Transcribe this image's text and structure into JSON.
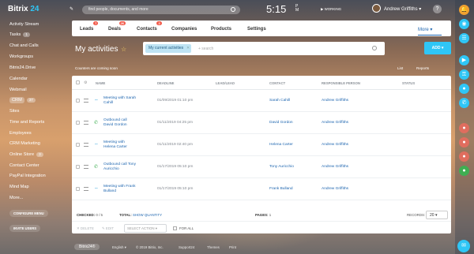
{
  "app": {
    "logo_text": "Bitrix",
    "logo_number": "24"
  },
  "sidebar": {
    "items": [
      {
        "label": "Activity Stream",
        "count": ""
      },
      {
        "label": "Tasks",
        "count": "1"
      },
      {
        "label": "Chat and Calls",
        "count": ""
      },
      {
        "label": "Workgroups",
        "count": ""
      },
      {
        "label": "Bitrix24.Drive",
        "count": ""
      },
      {
        "label": "Calendar",
        "count": ""
      },
      {
        "label": "Webmail",
        "count": ""
      },
      {
        "label": "CRM",
        "count": "37"
      },
      {
        "label": "Sites",
        "count": ""
      },
      {
        "label": "Time and Reports",
        "count": ""
      },
      {
        "label": "Employees",
        "count": ""
      },
      {
        "label": "CRM Marketing",
        "count": ""
      },
      {
        "label": "Online Store",
        "count": "3"
      },
      {
        "label": "Contact Center",
        "count": ""
      },
      {
        "label": "PayPal Integration",
        "count": ""
      },
      {
        "label": "Mind Map",
        "count": ""
      },
      {
        "label": "More...",
        "count": ""
      }
    ],
    "configure_menu": "CONFIGURE MENU",
    "invite_users": "INVITE USERS"
  },
  "topbar": {
    "search_placeholder": "find people, documents, and more",
    "clock": "5:15",
    "ampm_top": "P",
    "ampm_bottom": "M",
    "work_status": "WORKING",
    "user_name": "Andrew Griffiths",
    "help": "?"
  },
  "tabs": [
    {
      "label": "Leads",
      "badge": "7"
    },
    {
      "label": "Deals",
      "badge": "26"
    },
    {
      "label": "Contacts",
      "badge": "2"
    },
    {
      "label": "Companies",
      "badge": ""
    },
    {
      "label": "Products",
      "badge": ""
    },
    {
      "label": "Settings",
      "badge": ""
    }
  ],
  "more_tab": "More ▾",
  "page": {
    "title": "My activities",
    "filter_chip": "My current activities",
    "filter_placeholder": "+ search",
    "add_button": "ADD ▾",
    "counters_text": "Counters are coming soon",
    "view_list": "List",
    "view_reports": "Reports"
  },
  "grid": {
    "headers": [
      "NAME",
      "DEADLINE",
      "LEAD/LEAD",
      "CONTACT",
      "RESPONSIBLE PERSON",
      "STATUS"
    ],
    "rows": [
      {
        "type": "meeting",
        "name_line1": "Meeting with Sarah",
        "name_line2": "Cahill",
        "deadline": "01/09/2019 01:10 pm",
        "lead": "",
        "contact": "Sarah Cahill",
        "responsible": "Andrew Griffiths"
      },
      {
        "type": "call",
        "name_line1": "Outbound call",
        "name_line2": "David Gordon",
        "deadline": "01/11/2019 04:25 pm",
        "lead": "",
        "contact": "David Gordon",
        "responsible": "Andrew Griffiths"
      },
      {
        "type": "meeting",
        "name_line1": "Meeting with",
        "name_line2": "Helena Carter",
        "deadline": "01/11/2019 02:40 pm",
        "lead": "",
        "contact": "Helena Carter",
        "responsible": "Andrew Griffiths"
      },
      {
        "type": "call",
        "name_line1": "Outbound call Tony",
        "name_line2": "Auricchio",
        "deadline": "01/17/2019 05:10 pm",
        "lead": "",
        "contact": "Tony Auricchio",
        "responsible": "Andrew Griffiths"
      },
      {
        "type": "meeting",
        "name_line1": "Meeting with Frank",
        "name_line2": "Bulland",
        "deadline": "01/17/2019 05:10 pm",
        "lead": "",
        "contact": "Frank Bulland",
        "responsible": "Andrew Griffiths"
      }
    ],
    "checked_label": "CHECKED:",
    "checked_value": "0 / 5",
    "total_label": "TOTAL:",
    "total_value": "SHOW QUANTITY",
    "pages_label": "PAGES:",
    "pages_value": "1",
    "records_label": "RECORDS:",
    "records_value": "20 ▾"
  },
  "action_bar": {
    "delete": "✕ DELETE",
    "edit": "✎ EDIT",
    "select_action": "SELECT ACTION ▾",
    "for_all": "FOR ALL"
  },
  "footer": {
    "bitrix_btn": "Bitrix24®",
    "english": "English ▾",
    "copyright": "© 2019 Bitrix, Inc.",
    "support": "Support24",
    "themes": "Themes",
    "print": "Print"
  },
  "colors": {
    "accent": "#2fc6f6",
    "link": "#2067b0",
    "badge": "#f25b4b"
  }
}
